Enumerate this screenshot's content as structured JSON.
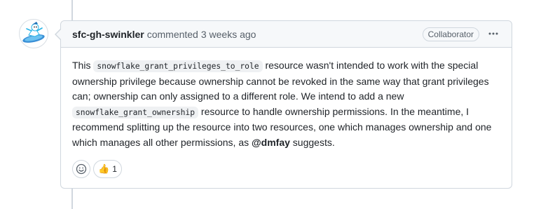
{
  "comment": {
    "author": "sfc-gh-swinkler",
    "action": "commented",
    "time": "3 weeks ago",
    "role_badge": "Collaborator",
    "more_icon": "kebab-horizontal-icon",
    "body": {
      "t1": "This ",
      "code1": "snowflake_grant_privileges_to_role",
      "t2": " resource wasn't intended to work with the special ownership privilege because ownership cannot be revoked in the same way that grant privileges can; ownership can only assigned to a different role. We intend to add a new ",
      "code2": "snowflake_grant_ownership",
      "t3": " resource to handle ownership permissions. In the meantime, I recommend splitting up the resource into two resources, one which manages ownership and one which manages all other permissions, as ",
      "mention": "@dmfay",
      "t4": " suggests."
    },
    "reactions": {
      "add_icon": "smiley-icon",
      "thumbs_up": {
        "emoji": "👍",
        "count": "1"
      }
    }
  },
  "colors": {
    "border": "#d0d7de",
    "header_bg": "#f6f8fa",
    "muted_text": "#57606a",
    "text": "#1f2328",
    "snowflake_blue": "#29b5e8"
  }
}
